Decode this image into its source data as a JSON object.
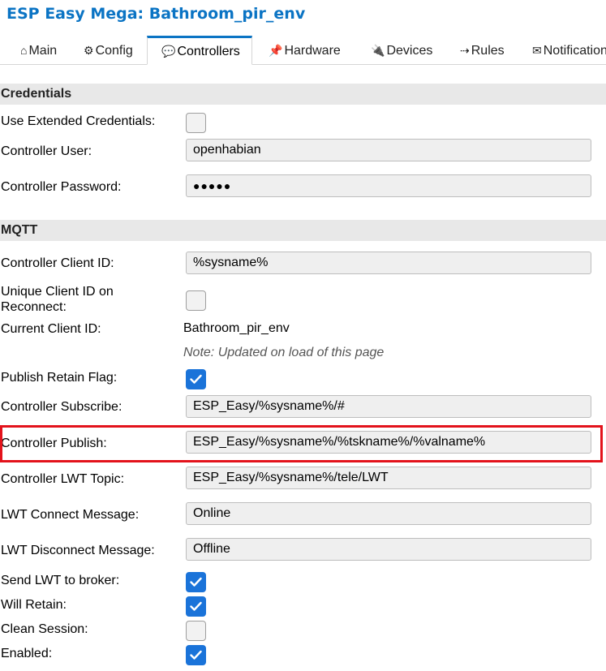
{
  "app_title": "ESP Easy Mega: Bathroom_pir_env",
  "tabs": [
    {
      "icon": "⌂",
      "label": "Main"
    },
    {
      "icon": "⚙",
      "label": "Config"
    },
    {
      "icon": "💬",
      "label": "Controllers"
    },
    {
      "icon": "📌",
      "label": "Hardware"
    },
    {
      "icon": "🔌",
      "label": "Devices"
    },
    {
      "icon": "⇢",
      "label": "Rules"
    },
    {
      "icon": "✉",
      "label": "Notifications"
    }
  ],
  "credentials": {
    "header": "Credentials",
    "use_extended_label": "Use Extended Credentials:",
    "use_extended_checked": false,
    "user_label": "Controller User:",
    "user_value": "openhabian",
    "password_label": "Controller Password:",
    "password_value": "●●●●●"
  },
  "mqtt": {
    "header": "MQTT",
    "client_id_label": "Controller Client ID:",
    "client_id_value": "%sysname%",
    "unique_client_label": "Unique Client ID on Reconnect:",
    "unique_client_checked": false,
    "current_client_label": "Current Client ID:",
    "current_client_value": "Bathroom_pir_env",
    "note": "Note: Updated on load of this page",
    "retain_label": "Publish Retain Flag:",
    "retain_checked": true,
    "subscribe_label": "Controller Subscribe:",
    "subscribe_value": "ESP_Easy/%sysname%/#",
    "publish_label": "Controller Publish:",
    "publish_value": "ESP_Easy/%sysname%/%tskname%/%valname%",
    "lwt_topic_label": "Controller LWT Topic:",
    "lwt_topic_value": "ESP_Easy/%sysname%/tele/LWT",
    "lwt_connect_label": "LWT Connect Message:",
    "lwt_connect_value": "Online",
    "lwt_disconnect_label": "LWT Disconnect Message:",
    "lwt_disconnect_value": "Offline",
    "send_lwt_label": "Send LWT to broker:",
    "send_lwt_checked": true,
    "will_retain_label": "Will Retain:",
    "will_retain_checked": true,
    "clean_session_label": "Clean Session:",
    "clean_session_checked": false,
    "enabled_label": "Enabled:",
    "enabled_checked": true
  },
  "colors": {
    "accent": "#0b74c4",
    "checkbox_on": "#1a73d9",
    "highlight": "#e3121b"
  }
}
